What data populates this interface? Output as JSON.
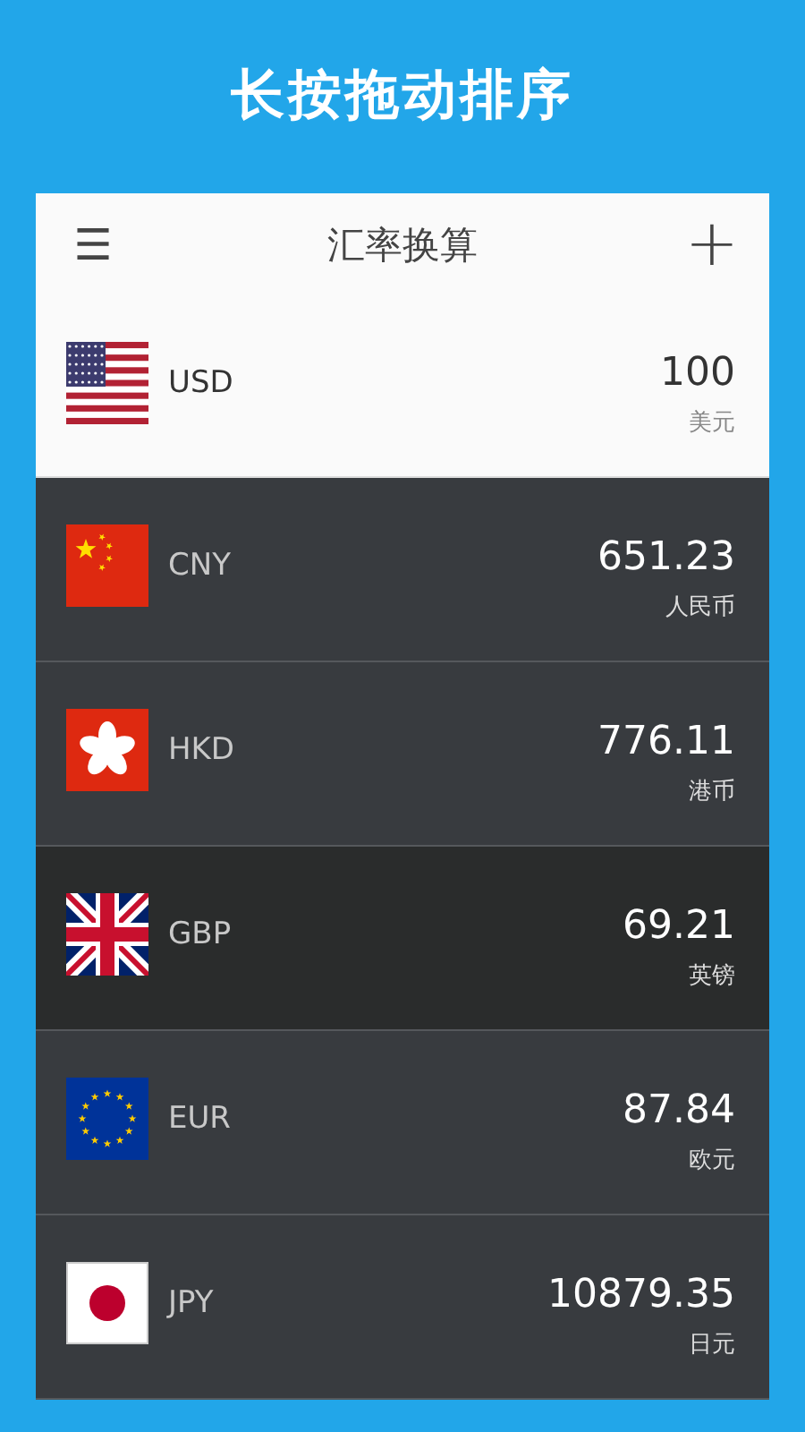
{
  "caption": "长按拖动排序",
  "app_bar": {
    "menu_icon": "☰",
    "title": "汇率换算",
    "add_icon": "+"
  },
  "currencies": [
    {
      "code": "USD",
      "amount": "100",
      "name": "美元",
      "base": true,
      "dragging": false
    },
    {
      "code": "CNY",
      "amount": "651.23",
      "name": "人民币",
      "base": false,
      "dragging": false
    },
    {
      "code": "HKD",
      "amount": "776.11",
      "name": "港币",
      "base": false,
      "dragging": false
    },
    {
      "code": "GBP",
      "amount": "69.21",
      "name": "英镑",
      "base": false,
      "dragging": true
    },
    {
      "code": "EUR",
      "amount": "87.84",
      "name": "欧元",
      "base": false,
      "dragging": false
    },
    {
      "code": "JPY",
      "amount": "10879.35",
      "name": "日元",
      "base": false,
      "dragging": false
    }
  ]
}
